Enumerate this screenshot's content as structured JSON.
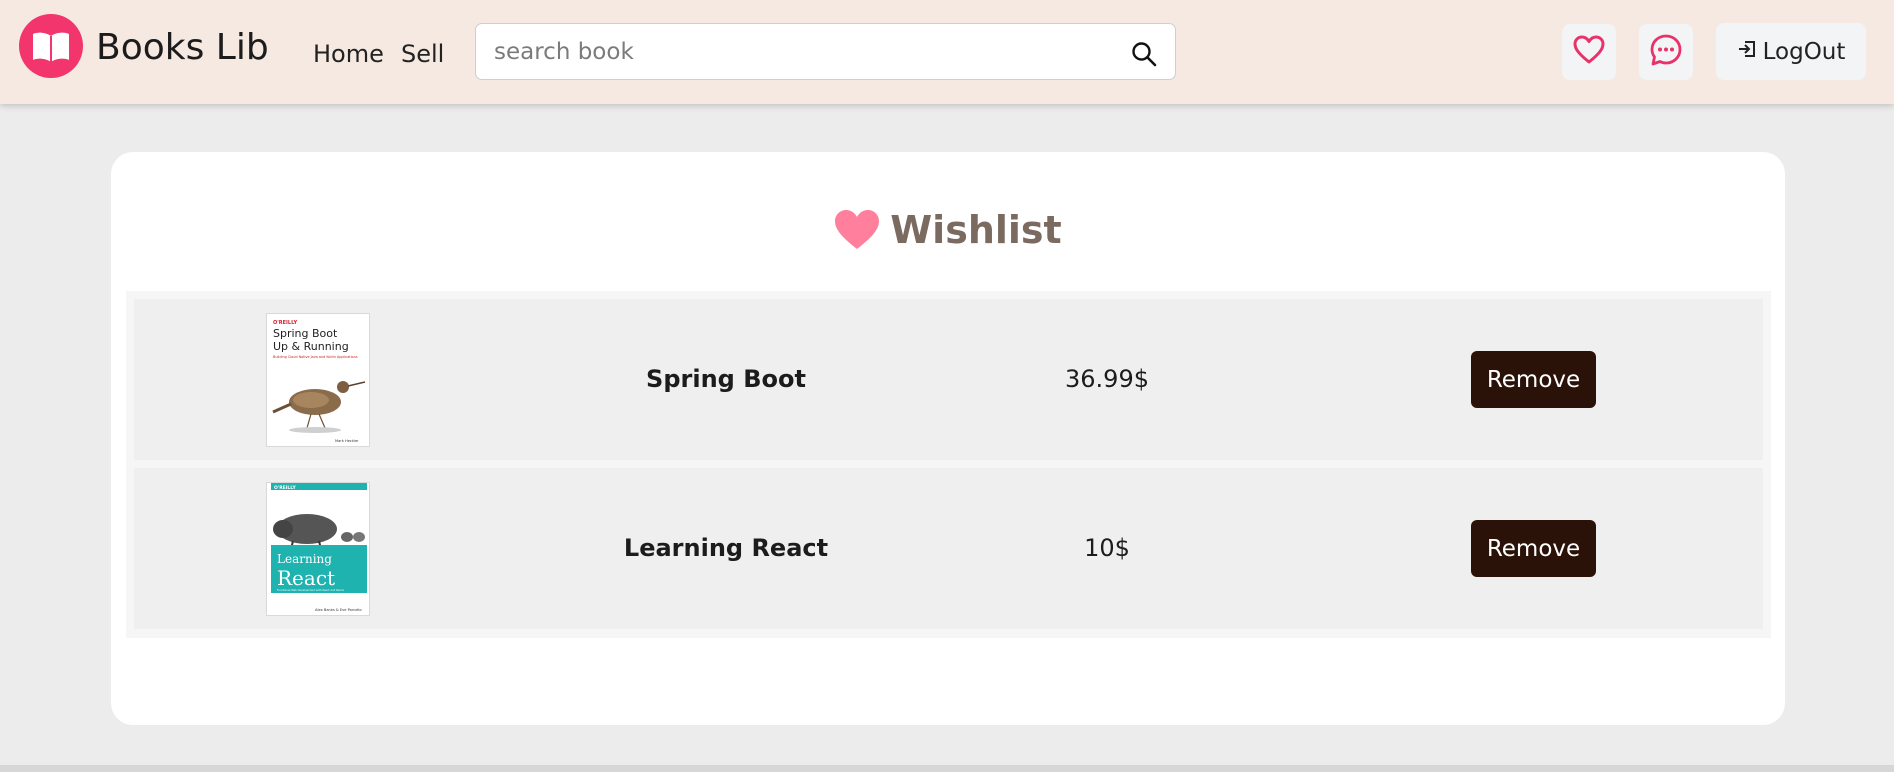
{
  "header": {
    "brand": "Books Lib",
    "nav": {
      "home": "Home",
      "sell": "Sell"
    },
    "search": {
      "placeholder": "search book",
      "value": ""
    },
    "logout_label": "LogOut"
  },
  "wishlist": {
    "title": "Wishlist",
    "items": [
      {
        "name": "Spring Boot",
        "price": "36.99$",
        "remove_label": "Remove",
        "cover": {
          "publisher": "O'REILLY",
          "title_line1": "Spring Boot",
          "title_line2": "Up & Running",
          "subtitle": "Building Cloud Native Java and Kotlin Applications",
          "author": "Mark Heckler"
        }
      },
      {
        "name": "Learning React",
        "price": "10$",
        "remove_label": "Remove",
        "cover": {
          "publisher": "O'REILLY",
          "title_line1": "Learning",
          "title_line2": "React",
          "subtitle": "Functional Web Development with React and Redux",
          "author": "Alex Banks & Eve Porcello"
        }
      }
    ]
  },
  "colors": {
    "accent": "#f2356d",
    "header_bg": "#f5e9e1",
    "remove_button": "#2a1208",
    "wishlist_heart": "#ff7f9c",
    "react_cover_teal": "#1fb3b0"
  },
  "icons": {
    "logo": "open-book-icon",
    "search": "search-icon",
    "wishlist": "heart-icon",
    "messages": "chat-bubble-icon",
    "logout": "logout-icon"
  }
}
